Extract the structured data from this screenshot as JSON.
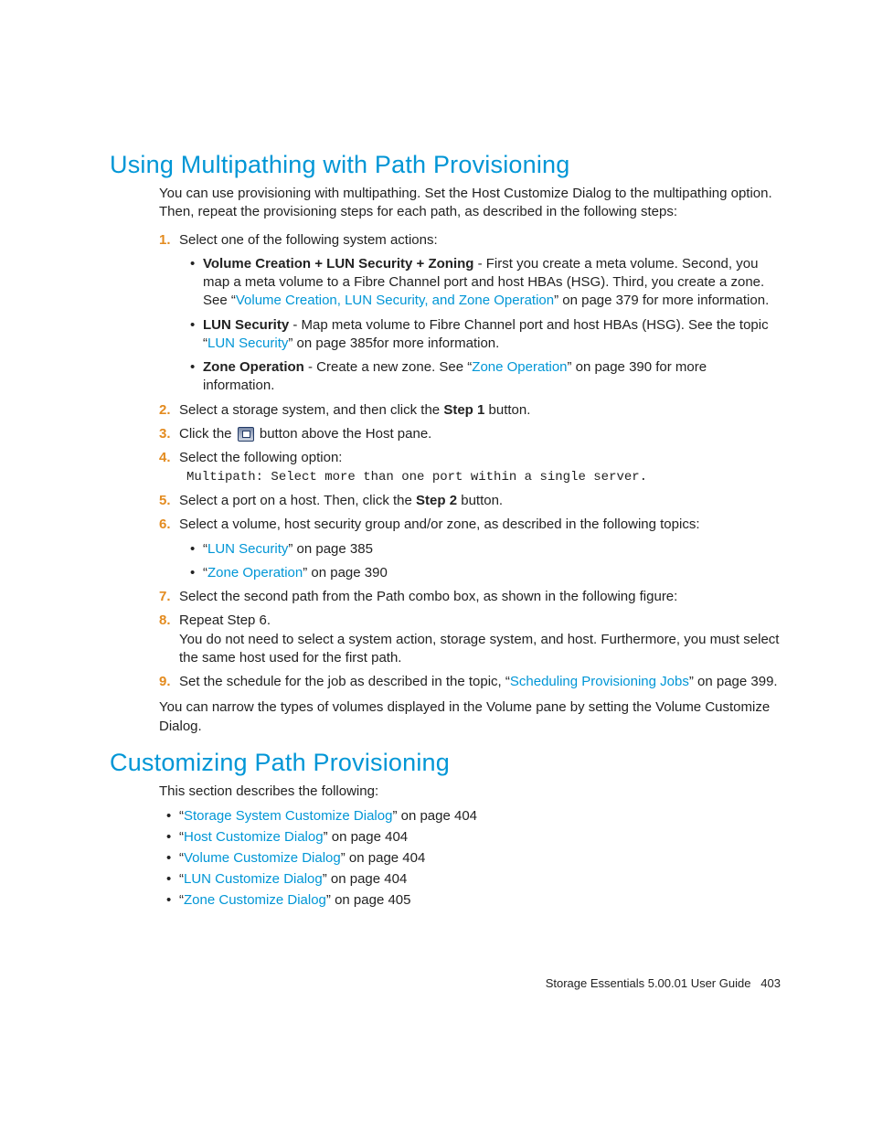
{
  "section1": {
    "heading": "Using Multipathing with Path Provisioning",
    "intro": "You can use provisioning with multipathing. Set the Host Customize Dialog to the multipathing option. Then, repeat the provisioning steps for each path, as described in the following steps:",
    "step1": {
      "text": "Select one of the following system actions:",
      "a": {
        "bold": "Volume Creation + LUN Security + Zoning",
        "t1": " - First you create a meta volume. Second, you map a meta volume to a Fibre Channel port and host HBAs (HSG). Third, you create a zone. See “",
        "link": "Volume Creation, LUN Security, and Zone Operation",
        "t2": "” on page 379 for more information."
      },
      "b": {
        "bold": "LUN Security",
        "t1": " - Map meta volume to Fibre Channel port and host HBAs (HSG). See the topic “",
        "link": "LUN Security",
        "t2": "” on page 385for more information."
      },
      "c": {
        "bold": "Zone Operation",
        "t1": " - Create a new zone. See “",
        "link": "Zone Operation",
        "t2": "” on page 390 for more information."
      }
    },
    "step2": {
      "t1": "Select a storage system, and then click the ",
      "bold": "Step 1",
      "t2": " button."
    },
    "step3": {
      "t1": "Click the ",
      "t2": " button above the Host pane."
    },
    "step4": {
      "text": "Select the following option:",
      "mono": "Multipath: Select more than one port within a single server."
    },
    "step5": {
      "t1": "Select a port on a host. Then, click the ",
      "bold": "Step 2",
      "t2": " button."
    },
    "step6": {
      "text": "Select a volume, host security group and/or zone, as described in the following topics:",
      "a": {
        "q1": "“",
        "link": "LUN Security",
        "q2": "” on page 385"
      },
      "b": {
        "q1": "“",
        "link": "Zone Operation",
        "q2": "” on page 390"
      }
    },
    "step7": "Select the second path from the Path combo box, as shown in the following figure:",
    "step8": {
      "line1": "Repeat Step 6.",
      "line2": "You do not need to select a system action, storage system, and host. Furthermore, you must select the same host used for the first path."
    },
    "step9": {
      "t1": "Set the schedule for the job as described in the topic, “",
      "link": "Scheduling Provisioning Jobs",
      "t2": "” on page 399."
    },
    "closing": "You can narrow the types of volumes displayed in the Volume pane by setting the Volume Customize Dialog."
  },
  "section2": {
    "heading": "Customizing Path Provisioning",
    "intro": "This section describes the following:",
    "items": [
      {
        "q1": "“",
        "link": "Storage System Customize Dialog",
        "q2": "” on page 404"
      },
      {
        "q1": "“",
        "link": "Host Customize Dialog",
        "q2": "” on page 404"
      },
      {
        "q1": "“",
        "link": "Volume Customize Dialog",
        "q2": "” on page 404"
      },
      {
        "q1": "“",
        "link": "LUN Customize Dialog",
        "q2": "” on page 404"
      },
      {
        "q1": "“",
        "link": "Zone Customize Dialog",
        "q2": "” on page 405"
      }
    ]
  },
  "footer": {
    "text": "Storage Essentials 5.00.01 User Guide",
    "page": "403"
  }
}
